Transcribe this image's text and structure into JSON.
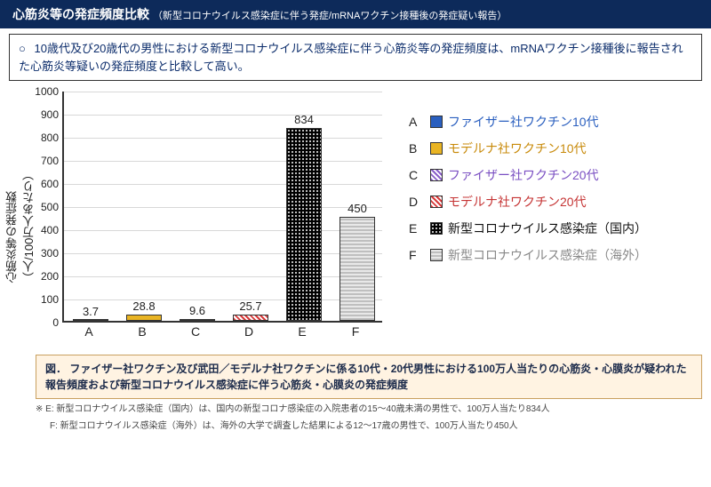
{
  "title_main": "心筋炎等の発症頻度比較",
  "title_sub": "（新型コロナウイルス感染症に伴う発症/mRNAワクチン接種後の発症疑い報告）",
  "summary": "10歳代及び20歳代の男性における新型コロナウイルス感染症に伴う心筋炎等の発症頻度は、mRNAワクチン接種後に報告された心筋炎等疑いの発症頻度と比較して高い。",
  "chart_data": {
    "type": "bar",
    "ylabel": "心筋炎等の発症数（人/100万人あたり）",
    "ylim": [
      0,
      1000
    ],
    "yticks": [
      0,
      100,
      200,
      300,
      400,
      500,
      600,
      700,
      800,
      900,
      1000
    ],
    "categories": [
      "A",
      "B",
      "C",
      "D",
      "E",
      "F"
    ],
    "values": [
      3.7,
      28.8,
      9.6,
      25.7,
      834,
      450
    ],
    "series_meta": [
      {
        "letter": "A",
        "label": "ファイザー社ワクチン10代",
        "color": "blue"
      },
      {
        "letter": "B",
        "label": "モデルナ社ワクチン10代",
        "color": "gold"
      },
      {
        "letter": "C",
        "label": "ファイザー社ワクチン20代",
        "color": "purple"
      },
      {
        "letter": "D",
        "label": "モデルナ社ワクチン20代",
        "color": "red"
      },
      {
        "letter": "E",
        "label": "新型コロナウイルス感染症（国内）",
        "color": "black"
      },
      {
        "letter": "F",
        "label": "新型コロナウイルス感染症（海外）",
        "color": "grey"
      }
    ]
  },
  "caption_prefix": "図．",
  "caption": "ファイザー社ワクチン及び武田／モデルナ社ワクチンに係る10代・20代男性における100万人当たりの心筋炎・心膜炎が疑われた報告頻度および新型コロナウイルス感染症に伴う心筋炎・心膜炎の発症頻度",
  "footnote_e": "※ E: 新型コロナウイルス感染症（国内）は、国内の新型コロナ感染症の入院患者の15～40歳未満の男性で、100万人当たり834人",
  "footnote_f": "F: 新型コロナウイルス感染症（海外）は、海外の大学で調査した結果による12～17歳の男性で、100万人当たり450人"
}
